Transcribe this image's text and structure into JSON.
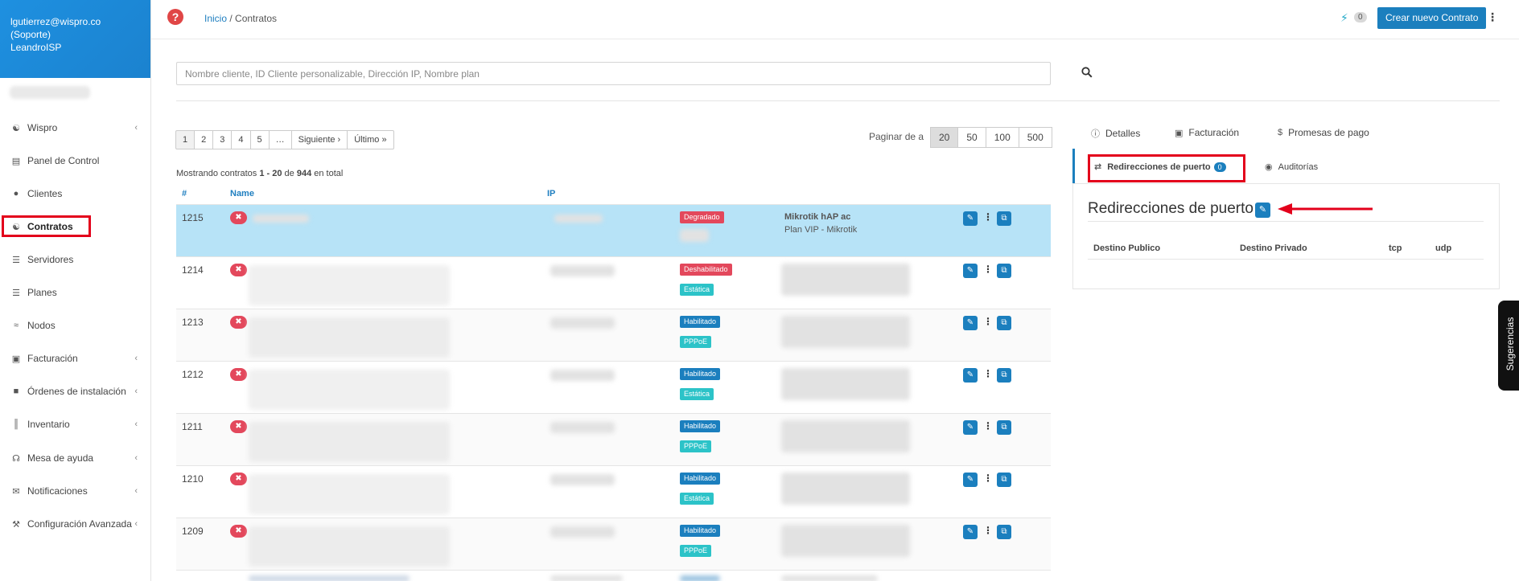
{
  "user": {
    "email": "lgutierrez@wispro.co",
    "role": "(Soporte)",
    "isp": "LeandroISP"
  },
  "sidebar": {
    "items": [
      {
        "label": "Wispro",
        "icon": "handshake-icon",
        "has_children": true
      },
      {
        "label": "Panel de Control",
        "icon": "chart-icon",
        "has_children": false
      },
      {
        "label": "Clientes",
        "icon": "users-icon",
        "has_children": false
      },
      {
        "label": "Contratos",
        "icon": "handshake-icon",
        "has_children": false,
        "active": true
      },
      {
        "label": "Servidores",
        "icon": "server-icon",
        "has_children": false
      },
      {
        "label": "Planes",
        "icon": "list-icon",
        "has_children": false
      },
      {
        "label": "Nodos",
        "icon": "wifi-icon",
        "has_children": false
      },
      {
        "label": "Facturación",
        "icon": "money-icon",
        "has_children": true
      },
      {
        "label": "Órdenes de instalación",
        "icon": "truck-icon",
        "has_children": true
      },
      {
        "label": "Inventario",
        "icon": "barcode-icon",
        "has_children": true
      },
      {
        "label": "Mesa de ayuda",
        "icon": "headset-icon",
        "has_children": true
      },
      {
        "label": "Notificaciones",
        "icon": "envelope-icon",
        "has_children": true
      },
      {
        "label": "Configuración Avanzada",
        "icon": "wrench-icon",
        "has_children": true
      }
    ]
  },
  "topbar": {
    "breadcrumb_home": "Inicio",
    "breadcrumb_sep": " / ",
    "breadcrumb_current": "Contratos",
    "notifications_count": "0",
    "new_contract_label": "Crear nuevo Contrato"
  },
  "search": {
    "placeholder": "Nombre cliente, ID Cliente personalizable, Dirección IP, Nombre plan"
  },
  "pagination": {
    "pages": [
      "1",
      "2",
      "3",
      "4",
      "5",
      "…",
      "Siguiente ›",
      "Último »"
    ],
    "per_page_label": "Paginar de a",
    "per_page_options": [
      "20",
      "50",
      "100",
      "500"
    ],
    "per_page_selected": "20"
  },
  "summary": {
    "prefix": "Mostrando contratos ",
    "range": "1 - 20",
    "of": " de ",
    "total": "944",
    "suffix": " en total"
  },
  "table": {
    "headers": {
      "id": "#",
      "name": "Name",
      "ip": "IP"
    },
    "rows": [
      {
        "id": "1215",
        "badges": [
          {
            "text": "Degradado",
            "color": "#e3485c"
          }
        ],
        "plan_name": "Mikrotik hAP ac",
        "plan_detail": "Plan VIP - Mikrotik"
      },
      {
        "id": "1214",
        "badges": [
          {
            "text": "Deshabilitado",
            "color": "#e3485c"
          },
          {
            "text": "Estática",
            "color": "#2cc3c8"
          }
        ]
      },
      {
        "id": "1213",
        "badges": [
          {
            "text": "Habilitado",
            "color": "#1b7fbe"
          },
          {
            "text": "PPPoE",
            "color": "#2cc3c8"
          }
        ]
      },
      {
        "id": "1212",
        "badges": [
          {
            "text": "Habilitado",
            "color": "#1b7fbe"
          },
          {
            "text": "Estática",
            "color": "#2cc3c8"
          }
        ]
      },
      {
        "id": "1211",
        "badges": [
          {
            "text": "Habilitado",
            "color": "#1b7fbe"
          },
          {
            "text": "PPPoE",
            "color": "#2cc3c8"
          }
        ]
      },
      {
        "id": "1210",
        "badges": [
          {
            "text": "Habilitado",
            "color": "#1b7fbe"
          },
          {
            "text": "Estática",
            "color": "#2cc3c8"
          }
        ]
      },
      {
        "id": "1209",
        "badges": [
          {
            "text": "Habilitado",
            "color": "#1b7fbe"
          },
          {
            "text": "PPPoE",
            "color": "#2cc3c8"
          }
        ]
      }
    ]
  },
  "details_panel": {
    "tabs": [
      {
        "label": "Detalles",
        "icon": "info-icon"
      },
      {
        "label": "Facturación",
        "icon": "money-icon"
      },
      {
        "label": "Promesas de pago",
        "icon": "dollar-icon"
      },
      {
        "label": "Redirecciones de puerto",
        "icon": "shuffle-icon",
        "count": "0",
        "active": true
      },
      {
        "label": "Auditorías",
        "icon": "eye-icon"
      }
    ],
    "title": "Redirecciones de puerto",
    "columns": [
      "Destino Publico",
      "Destino Privado",
      "tcp",
      "udp"
    ]
  },
  "feedback": {
    "label": "Sugerencias"
  },
  "colors": {
    "primary": "#1b7fbe",
    "sidebar_header": "#1b82cf",
    "danger": "#e3485c",
    "info": "#2cc3c8",
    "selected_row": "#b7e3f7",
    "highlight": "#e3001b"
  }
}
